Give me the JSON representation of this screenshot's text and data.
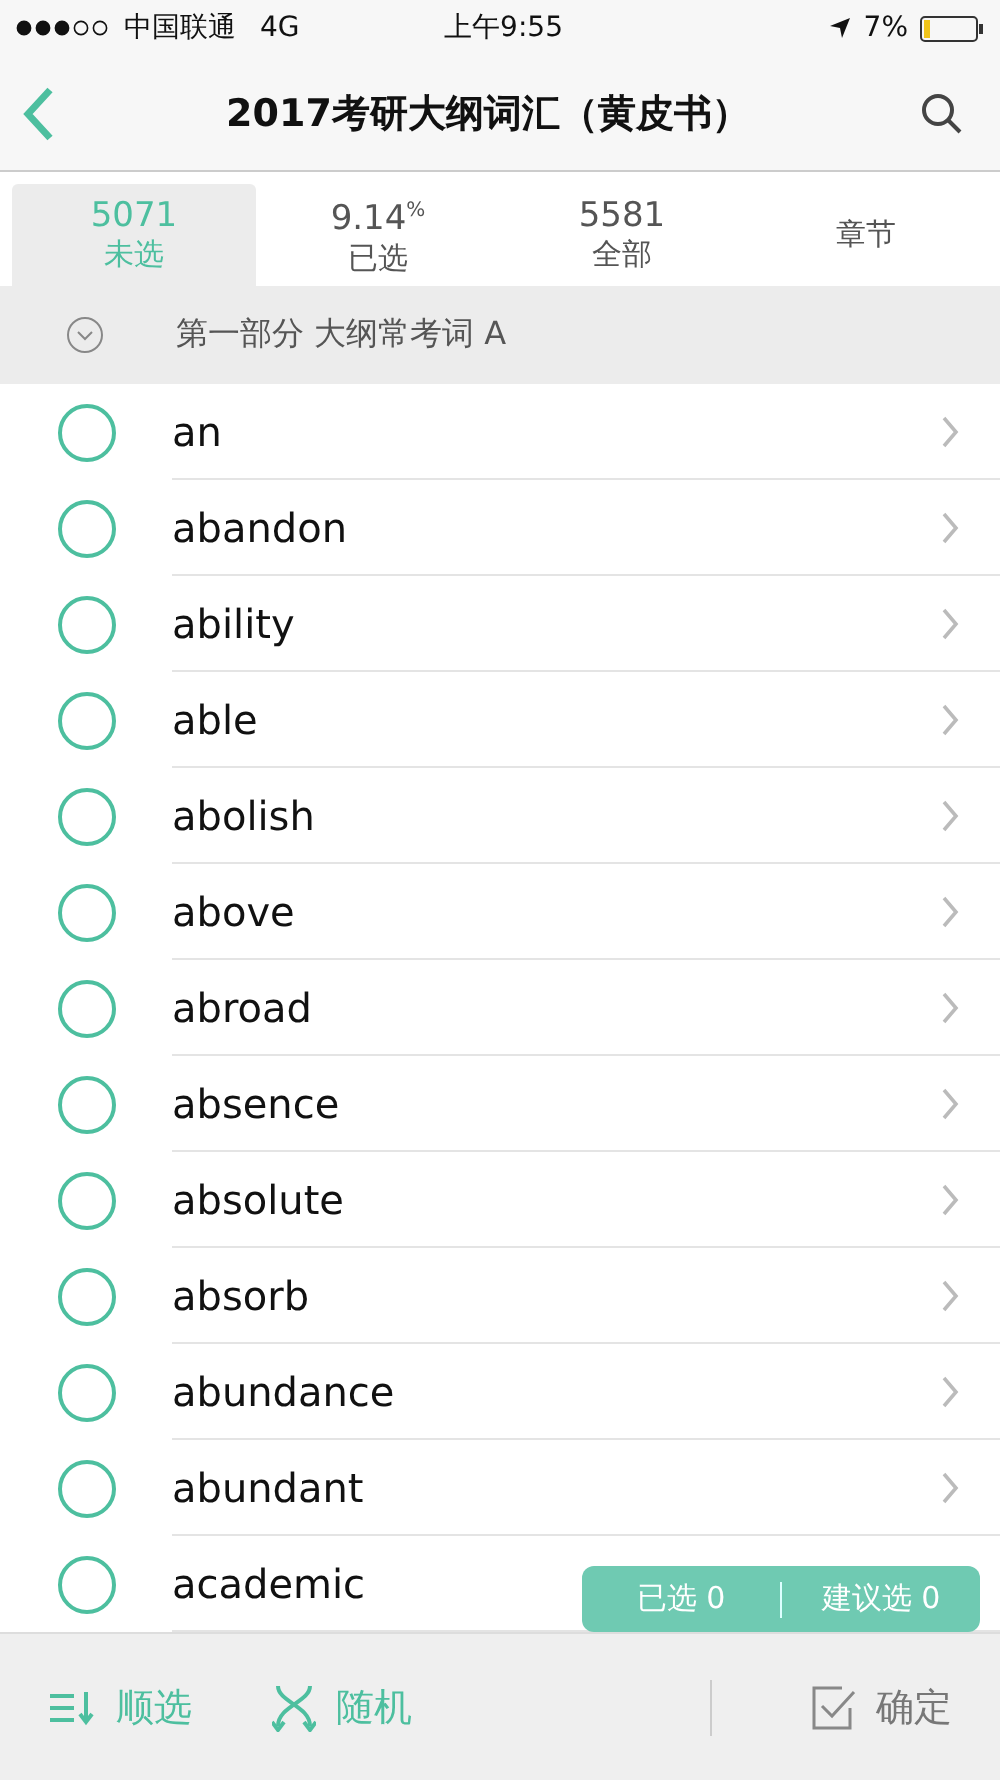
{
  "status_bar": {
    "carrier": "中国联通",
    "network": "4G",
    "time": "上午9:55",
    "battery": "7%"
  },
  "nav": {
    "title": "2017考研大纲词汇（黄皮书）"
  },
  "tabs": [
    {
      "value": "5071",
      "label": "未选",
      "selected": true
    },
    {
      "value": "9.14",
      "unit": "%",
      "label": "已选",
      "selected": false
    },
    {
      "value": "5581",
      "label": "全部",
      "selected": false
    },
    {
      "label": "章节",
      "selected": false
    }
  ],
  "section": {
    "title": "第一部分 大纲常考词 A",
    "expanded": true
  },
  "words": [
    {
      "word": "an",
      "checked": false
    },
    {
      "word": "abandon",
      "checked": false
    },
    {
      "word": "ability",
      "checked": false
    },
    {
      "word": "able",
      "checked": false
    },
    {
      "word": "abolish",
      "checked": false
    },
    {
      "word": "above",
      "checked": false
    },
    {
      "word": "abroad",
      "checked": false
    },
    {
      "word": "absence",
      "checked": false
    },
    {
      "word": "absolute",
      "checked": false
    },
    {
      "word": "absorb",
      "checked": false
    },
    {
      "word": "abundance",
      "checked": false
    },
    {
      "word": "abundant",
      "checked": false
    },
    {
      "word": "academic",
      "checked": false
    }
  ],
  "summary": {
    "selected": "已选 0",
    "suggested": "建议选 0"
  },
  "bottom_bar": {
    "sequential": "顺选",
    "random": "随机",
    "confirm": "确定"
  }
}
